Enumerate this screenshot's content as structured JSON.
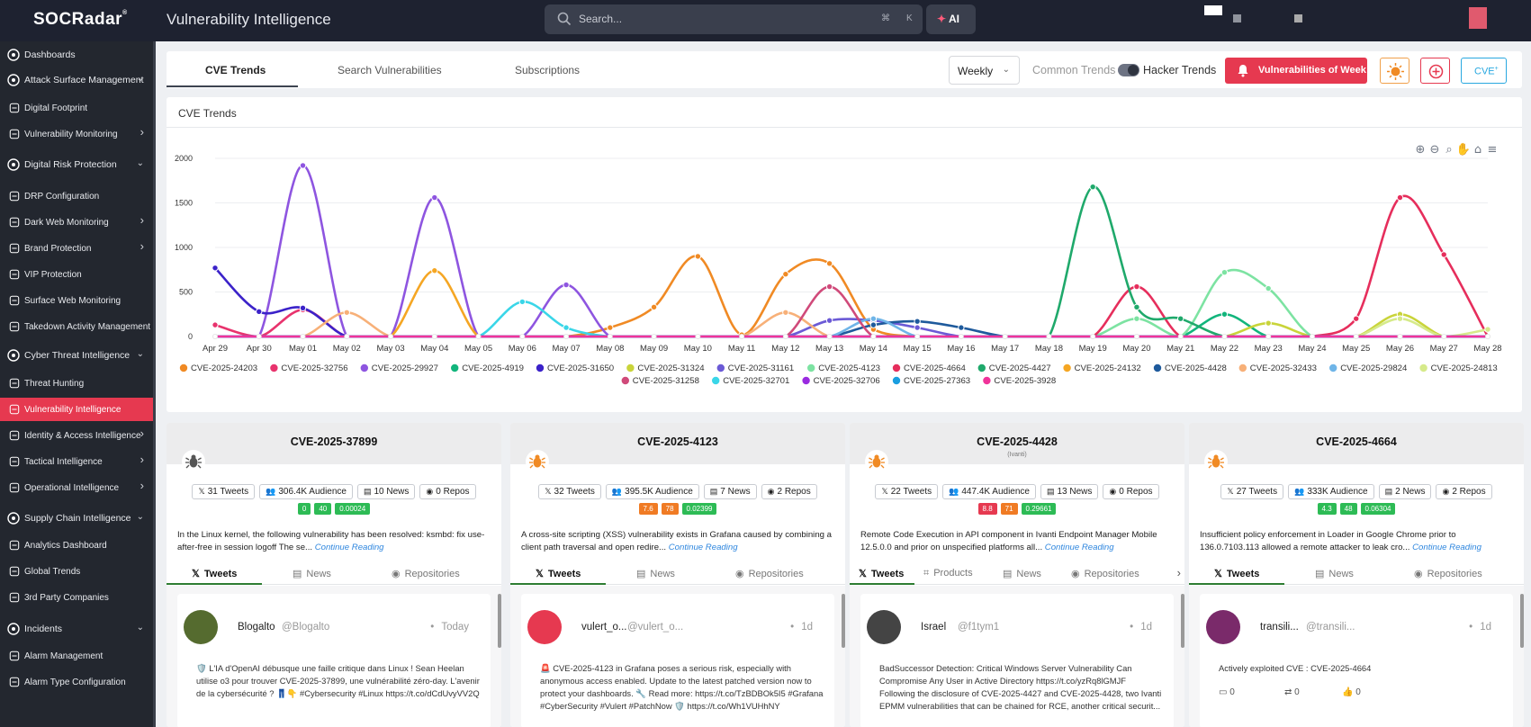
{
  "app": {
    "logo": "SOCRadar",
    "title": "Vulnerability Intelligence"
  },
  "search": {
    "placeholder": "Search...",
    "shortcut_cmd": "⌘",
    "shortcut_key": "K",
    "ai_label": "AI"
  },
  "sidebar": {
    "items": [
      {
        "label": "Dashboards",
        "icon": "dashboard-icon",
        "kind": "main"
      },
      {
        "label": "Attack Surface Management",
        "icon": "shield-icon",
        "kind": "main",
        "chevron": "down"
      },
      {
        "label": "Digital Footprint",
        "icon": "footprint-icon",
        "kind": "sub"
      },
      {
        "label": "Vulnerability Monitoring",
        "icon": "gear-icon",
        "kind": "sub",
        "chevron": "right"
      },
      {
        "label": "Digital Risk Protection",
        "icon": "hand-icon",
        "kind": "main",
        "chevron": "down"
      },
      {
        "label": "DRP Configuration",
        "icon": "list-icon",
        "kind": "sub"
      },
      {
        "label": "Dark Web Monitoring",
        "icon": "laptop-icon",
        "kind": "sub",
        "chevron": "right"
      },
      {
        "label": "Brand Protection",
        "icon": "brand-icon",
        "kind": "sub",
        "chevron": "right"
      },
      {
        "label": "VIP Protection",
        "icon": "vip-icon",
        "kind": "sub"
      },
      {
        "label": "Surface Web Monitoring",
        "icon": "globe-icon",
        "kind": "sub"
      },
      {
        "label": "Takedown Activity Management",
        "icon": "takedown-icon",
        "kind": "sub"
      },
      {
        "label": "Cyber Threat Intelligence",
        "icon": "shield-icon",
        "kind": "main",
        "chevron": "down"
      },
      {
        "label": "Threat Hunting",
        "icon": "search-icon",
        "kind": "sub"
      },
      {
        "label": "Vulnerability Intelligence",
        "icon": "bug-icon",
        "kind": "sub",
        "active": true
      },
      {
        "label": "Identity & Access Intelligence",
        "icon": "id-icon",
        "kind": "sub",
        "chevron": "right"
      },
      {
        "label": "Tactical Intelligence",
        "icon": "tactical-icon",
        "kind": "sub",
        "chevron": "right"
      },
      {
        "label": "Operational Intelligence",
        "icon": "gear-icon",
        "kind": "sub",
        "chevron": "right"
      },
      {
        "label": "Supply Chain Intelligence",
        "icon": "chain-icon",
        "kind": "main",
        "chevron": "down"
      },
      {
        "label": "Analytics Dashboard",
        "icon": "analytics-icon",
        "kind": "sub"
      },
      {
        "label": "Global Trends",
        "icon": "trends-icon",
        "kind": "sub"
      },
      {
        "label": "3rd Party Companies",
        "icon": "building-icon",
        "kind": "sub"
      },
      {
        "label": "Incidents",
        "icon": "incident-icon",
        "kind": "main",
        "chevron": "down"
      },
      {
        "label": "Alarm Management",
        "icon": "alarm-icon",
        "kind": "sub"
      },
      {
        "label": "Alarm Type Configuration",
        "icon": "alarm-config-icon",
        "kind": "sub"
      }
    ]
  },
  "tabs": {
    "cve_trends": "CVE Trends",
    "search_vulns": "Search Vulnerabilities",
    "subscriptions": "Subscriptions"
  },
  "toolbar": {
    "period": "Weekly",
    "common_trends": "Common Trends",
    "hacker_trends": "Hacker Trends",
    "vow_button": "Vulnerabilities of Week",
    "cve_button": "CVE",
    "cve_button_sup": "+"
  },
  "chart_panel": {
    "title": "CVE Trends"
  },
  "chart_data": {
    "type": "line",
    "title": "",
    "ylim": [
      0,
      2000
    ],
    "yticks": [
      0,
      500,
      1000,
      1500,
      2000
    ],
    "categories": [
      "Apr 29",
      "Apr 30",
      "May 01",
      "May 02",
      "May 03",
      "May 04",
      "May 05",
      "May 06",
      "May 07",
      "May 08",
      "May 09",
      "May 10",
      "May 11",
      "May 12",
      "May 13",
      "May 14",
      "May 15",
      "May 16",
      "May 17",
      "May 18",
      "May 19",
      "May 20",
      "May 21",
      "May 22",
      "May 23",
      "May 24",
      "May 25",
      "May 26",
      "May 27",
      "May 28"
    ],
    "legend_placement": "bottom",
    "series": [
      {
        "name": "CVE-2025-24203",
        "color": "#f08a24",
        "values": [
          0,
          0,
          0,
          0,
          0,
          0,
          0,
          0,
          0,
          100,
          330,
          900,
          20,
          700,
          820,
          80,
          0,
          0,
          0,
          0,
          0,
          0,
          0,
          0,
          0,
          0,
          0,
          0,
          0,
          0
        ]
      },
      {
        "name": "CVE-2025-32756",
        "color": "#e8336d",
        "values": [
          130,
          0,
          300,
          0,
          0,
          0,
          0,
          0,
          0,
          0,
          0,
          0,
          0,
          0,
          0,
          0,
          0,
          0,
          0,
          0,
          0,
          0,
          0,
          0,
          0,
          0,
          0,
          0,
          0,
          0
        ]
      },
      {
        "name": "CVE-2025-29927",
        "color": "#8e55e0",
        "values": [
          0,
          0,
          1920,
          0,
          0,
          1560,
          0,
          0,
          580,
          0,
          0,
          0,
          0,
          0,
          0,
          0,
          0,
          0,
          0,
          0,
          0,
          0,
          0,
          0,
          0,
          0,
          0,
          0,
          0,
          0
        ]
      },
      {
        "name": "CVE-2025-4919",
        "color": "#12b57c",
        "values": [
          0,
          0,
          0,
          0,
          0,
          0,
          0,
          0,
          0,
          0,
          0,
          0,
          0,
          0,
          0,
          0,
          0,
          0,
          0,
          0,
          0,
          0,
          0,
          250,
          0,
          0,
          0,
          0,
          0,
          0
        ]
      },
      {
        "name": "CVE-2025-31650",
        "color": "#3b22c9",
        "values": [
          770,
          280,
          320,
          0,
          0,
          0,
          0,
          0,
          0,
          0,
          0,
          0,
          0,
          0,
          0,
          0,
          0,
          0,
          0,
          0,
          0,
          0,
          0,
          0,
          0,
          0,
          0,
          0,
          0,
          0
        ]
      },
      {
        "name": "CVE-2025-31324",
        "color": "#c9d43a",
        "values": [
          0,
          0,
          0,
          0,
          0,
          0,
          0,
          0,
          0,
          0,
          0,
          0,
          0,
          0,
          0,
          0,
          0,
          0,
          0,
          0,
          0,
          0,
          0,
          0,
          150,
          0,
          0,
          250,
          0,
          0
        ]
      },
      {
        "name": "CVE-2025-31161",
        "color": "#6b5ad6",
        "values": [
          0,
          0,
          0,
          0,
          0,
          0,
          0,
          0,
          0,
          0,
          0,
          0,
          0,
          0,
          180,
          180,
          100,
          0,
          0,
          0,
          0,
          0,
          0,
          0,
          0,
          0,
          0,
          0,
          0,
          0
        ]
      },
      {
        "name": "CVE-2025-4123",
        "color": "#7de3a2",
        "values": [
          0,
          0,
          0,
          0,
          0,
          0,
          0,
          0,
          0,
          0,
          0,
          0,
          0,
          0,
          0,
          0,
          0,
          0,
          0,
          0,
          0,
          200,
          0,
          720,
          540,
          0,
          0,
          0,
          0,
          0
        ]
      },
      {
        "name": "CVE-2025-4664",
        "color": "#e62e5c",
        "values": [
          0,
          0,
          0,
          0,
          0,
          0,
          0,
          0,
          0,
          0,
          0,
          0,
          0,
          0,
          0,
          0,
          0,
          0,
          0,
          0,
          0,
          560,
          0,
          0,
          0,
          0,
          200,
          1560,
          920,
          0
        ]
      },
      {
        "name": "CVE-2025-4427",
        "color": "#1fa96b",
        "values": [
          0,
          0,
          0,
          0,
          0,
          0,
          0,
          0,
          0,
          0,
          0,
          0,
          0,
          0,
          0,
          0,
          0,
          0,
          0,
          0,
          1680,
          330,
          200,
          0,
          0,
          0,
          0,
          0,
          0,
          0
        ]
      },
      {
        "name": "CVE-2025-24132",
        "color": "#f5a623",
        "values": [
          0,
          0,
          0,
          0,
          0,
          740,
          0,
          0,
          0,
          0,
          0,
          0,
          0,
          0,
          0,
          0,
          0,
          0,
          0,
          0,
          0,
          0,
          0,
          0,
          0,
          0,
          0,
          0,
          0,
          0
        ]
      },
      {
        "name": "CVE-2025-4428",
        "color": "#1e5a9c",
        "values": [
          0,
          0,
          0,
          0,
          0,
          0,
          0,
          0,
          0,
          0,
          0,
          0,
          0,
          0,
          0,
          130,
          170,
          100,
          0,
          0,
          0,
          0,
          0,
          0,
          0,
          0,
          0,
          0,
          0,
          0
        ]
      },
      {
        "name": "CVE-2025-32433",
        "color": "#f7b078",
        "values": [
          0,
          0,
          0,
          270,
          0,
          0,
          0,
          0,
          0,
          0,
          0,
          0,
          0,
          270,
          0,
          0,
          0,
          0,
          0,
          0,
          0,
          0,
          0,
          0,
          0,
          0,
          0,
          0,
          0,
          0
        ]
      },
      {
        "name": "CVE-2025-29824",
        "color": "#6fb5e8",
        "values": [
          0,
          0,
          0,
          0,
          0,
          0,
          0,
          0,
          0,
          0,
          0,
          0,
          0,
          0,
          0,
          200,
          0,
          0,
          0,
          0,
          0,
          0,
          0,
          0,
          0,
          0,
          0,
          0,
          0,
          0
        ]
      },
      {
        "name": "CVE-2025-24813",
        "color": "#d6ea8a",
        "values": [
          0,
          0,
          0,
          0,
          0,
          0,
          0,
          0,
          0,
          0,
          0,
          0,
          0,
          0,
          0,
          0,
          0,
          0,
          0,
          0,
          0,
          0,
          0,
          0,
          0,
          0,
          0,
          200,
          0,
          80
        ]
      },
      {
        "name": "CVE-2025-31258",
        "color": "#d04a7a",
        "values": [
          0,
          0,
          0,
          0,
          0,
          0,
          0,
          0,
          0,
          0,
          0,
          0,
          0,
          0,
          560,
          0,
          0,
          0,
          0,
          0,
          0,
          0,
          0,
          0,
          0,
          0,
          0,
          0,
          0,
          0
        ]
      },
      {
        "name": "CVE-2025-32701",
        "color": "#3ad6e8",
        "values": [
          0,
          0,
          0,
          0,
          0,
          0,
          0,
          390,
          100,
          0,
          0,
          0,
          0,
          0,
          0,
          0,
          0,
          0,
          0,
          0,
          0,
          0,
          0,
          0,
          0,
          0,
          0,
          0,
          0,
          0
        ]
      },
      {
        "name": "CVE-2025-32706",
        "color": "#9a2be0",
        "values": [
          0,
          0,
          0,
          0,
          0,
          0,
          0,
          0,
          0,
          0,
          0,
          0,
          0,
          0,
          0,
          0,
          0,
          0,
          0,
          0,
          0,
          0,
          0,
          0,
          0,
          0,
          0,
          0,
          0,
          0
        ]
      },
      {
        "name": "CVE-2025-27363",
        "color": "#1a9ee0",
        "values": [
          0,
          0,
          0,
          0,
          0,
          0,
          0,
          0,
          0,
          0,
          0,
          0,
          0,
          0,
          0,
          0,
          0,
          0,
          0,
          0,
          0,
          0,
          0,
          0,
          0,
          0,
          0,
          0,
          0,
          0
        ]
      },
      {
        "name": "CVE-2025-3928",
        "color": "#f0339a",
        "values": [
          0,
          0,
          0,
          0,
          0,
          0,
          0,
          0,
          0,
          0,
          0,
          0,
          0,
          0,
          0,
          0,
          0,
          0,
          0,
          0,
          0,
          0,
          0,
          0,
          0,
          0,
          0,
          0,
          0,
          0
        ]
      }
    ]
  },
  "cards": [
    {
      "cve": "CVE-2025-37899",
      "sub": "",
      "bug_color": "#555",
      "stats": [
        "31 Tweets",
        "306.4K Audience",
        "10 News",
        "0 Repos"
      ],
      "scores": [
        {
          "v": "0",
          "c": "#2dbb55"
        },
        {
          "v": "40",
          "c": "#2dbb55"
        },
        {
          "v": "0.00024",
          "c": "#2dbb55"
        }
      ],
      "desc": "In the Linux kernel, the following vulnerability has been resolved: ksmbd: fix use-after-free in session logoff The se...",
      "more": "Continue Reading",
      "tabs": [
        "Tweets",
        "News",
        "Repositories"
      ],
      "tweet": {
        "user": "Blogalto",
        "handle": "@Blogalto",
        "time": "Today",
        "avatar_color": "#556b2f",
        "text": "🛡️ L'IA d'OpenAI débusque une faille critique dans Linux ! Sean Heelan utilise o3 pour trouver CVE-2025-37899, une vulnérabilité zéro-day. L'avenir de la cybersécurité ? 👖👇 #Cybersecurity #Linux https://t.co/dCdUvyVV2Q"
      }
    },
    {
      "cve": "CVE-2025-4123",
      "sub": "",
      "bug_color": "#f08a24",
      "stats": [
        "32 Tweets",
        "395.5K Audience",
        "7 News",
        "2 Repos"
      ],
      "scores": [
        {
          "v": "7.6",
          "c": "#f07b24"
        },
        {
          "v": "78",
          "c": "#f07b24"
        },
        {
          "v": "0.02399",
          "c": "#2dbb55"
        }
      ],
      "desc": "A cross-site scripting (XSS) vulnerability exists in Grafana caused by combining a client path traversal and open redire...",
      "more": "Continue Reading",
      "tabs": [
        "Tweets",
        "News",
        "Repositories"
      ],
      "tweet": {
        "user": "vulert_o...",
        "handle": "@vulert_o...",
        "time": "1d",
        "avatar_color": "#e63950",
        "text": "🚨 CVE-2025-4123 in Grafana poses a serious risk, especially with anonymous access enabled. Update to the latest patched version now to protect your dashboards. 🔧 Read more: https://t.co/TzBDBOk5I5 #Grafana #CyberSecurity #Vulert #PatchNow 🛡️ https://t.co/Wh1VUHhNY"
      }
    },
    {
      "cve": "CVE-2025-4428",
      "sub": "(Ivanti)",
      "bug_color": "#f08a24",
      "stats": [
        "22 Tweets",
        "447.4K Audience",
        "13 News",
        "0 Repos"
      ],
      "scores": [
        {
          "v": "8.8",
          "c": "#e63950"
        },
        {
          "v": "71",
          "c": "#f07b24"
        },
        {
          "v": "0.29661",
          "c": "#2dbb55"
        }
      ],
      "desc": "Remote Code Execution in API component in Ivanti Endpoint Manager Mobile 12.5.0.0 and prior on unspecified platforms all...",
      "more": "Continue Reading",
      "tabs": [
        "Tweets",
        "Products",
        "News",
        "Repositories"
      ],
      "tweet": {
        "user": "Israel",
        "handle": "@f1tym1",
        "time": "1d",
        "avatar_color": "#444",
        "text": "BadSuccessor Detection: Critical Windows Server Vulnerability Can Compromise Any User in Active Directory https://t.co/yzRq8lGMJF Following the disclosure of CVE-2025-4427 and CVE-2025-4428, two Ivanti EPMM vulnerabilities that can be chained for RCE, another critical securit..."
      }
    },
    {
      "cve": "CVE-2025-4664",
      "sub": "",
      "bug_color": "#f08a24",
      "stats": [
        "27 Tweets",
        "333K Audience",
        "2 News",
        "2 Repos"
      ],
      "scores": [
        {
          "v": "4.3",
          "c": "#2dbb55"
        },
        {
          "v": "48",
          "c": "#2dbb55"
        },
        {
          "v": "0.06304",
          "c": "#2dbb55"
        }
      ],
      "desc": "Insufficient policy enforcement in Loader in Google Chrome prior to 136.0.7103.113 allowed a remote attacker to leak cro...",
      "more": "Continue Reading",
      "tabs": [
        "Tweets",
        "News",
        "Repositories"
      ],
      "tweet": {
        "user": "transili...",
        "handle": "@transili...",
        "time": "1d",
        "avatar_color": "#7a2a6a",
        "text": "Actively exploited CVE : CVE-2025-4664",
        "replies": "0",
        "retweets": "0",
        "likes": "0"
      }
    }
  ]
}
